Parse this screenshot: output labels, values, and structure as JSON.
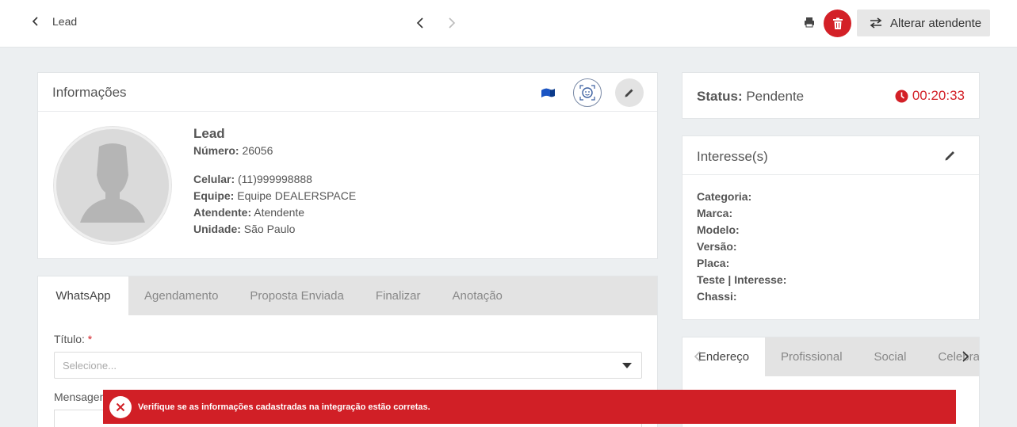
{
  "topbar": {
    "back_label": "Lead",
    "alterar_label": "Alterar atendente"
  },
  "info": {
    "title": "Informações",
    "name": "Lead",
    "numero_label": "Número:",
    "numero_value": " 26056",
    "celular_label": "Celular:",
    "celular_value": " (11)999998888",
    "equipe_label": "Equipe:",
    "equipe_value": " Equipe DEALERSPACE",
    "atendente_label": "Atendente:",
    "atendente_value": " Atendente",
    "unidade_label": "Unidade:",
    "unidade_value": " São Paulo"
  },
  "tabs": {
    "items": [
      "WhatsApp",
      "Agendamento",
      "Proposta Enviada",
      "Finalizar",
      "Anotação"
    ],
    "titulo_label": "Título:",
    "required_mark": "*",
    "select_placeholder": "Selecione...",
    "mensagem_label": "Mensagem"
  },
  "status": {
    "label": "Status:",
    "value": " Pendente",
    "timer": "00:20:33"
  },
  "interesses": {
    "title": "Interesse(s)",
    "fields": [
      "Categoria:",
      "Marca:",
      "Modelo:",
      "Versão:",
      "Placa:",
      "Teste | Interesse:",
      "Chassi:"
    ]
  },
  "address_tabs": {
    "items": [
      "Endereço",
      "Profissional",
      "Social",
      "Celebra"
    ]
  },
  "toast": {
    "message": "Verifique se as informações cadastradas na integração estão corretas."
  },
  "colors": {
    "danger": "#d32027",
    "background": "#eceff1"
  }
}
